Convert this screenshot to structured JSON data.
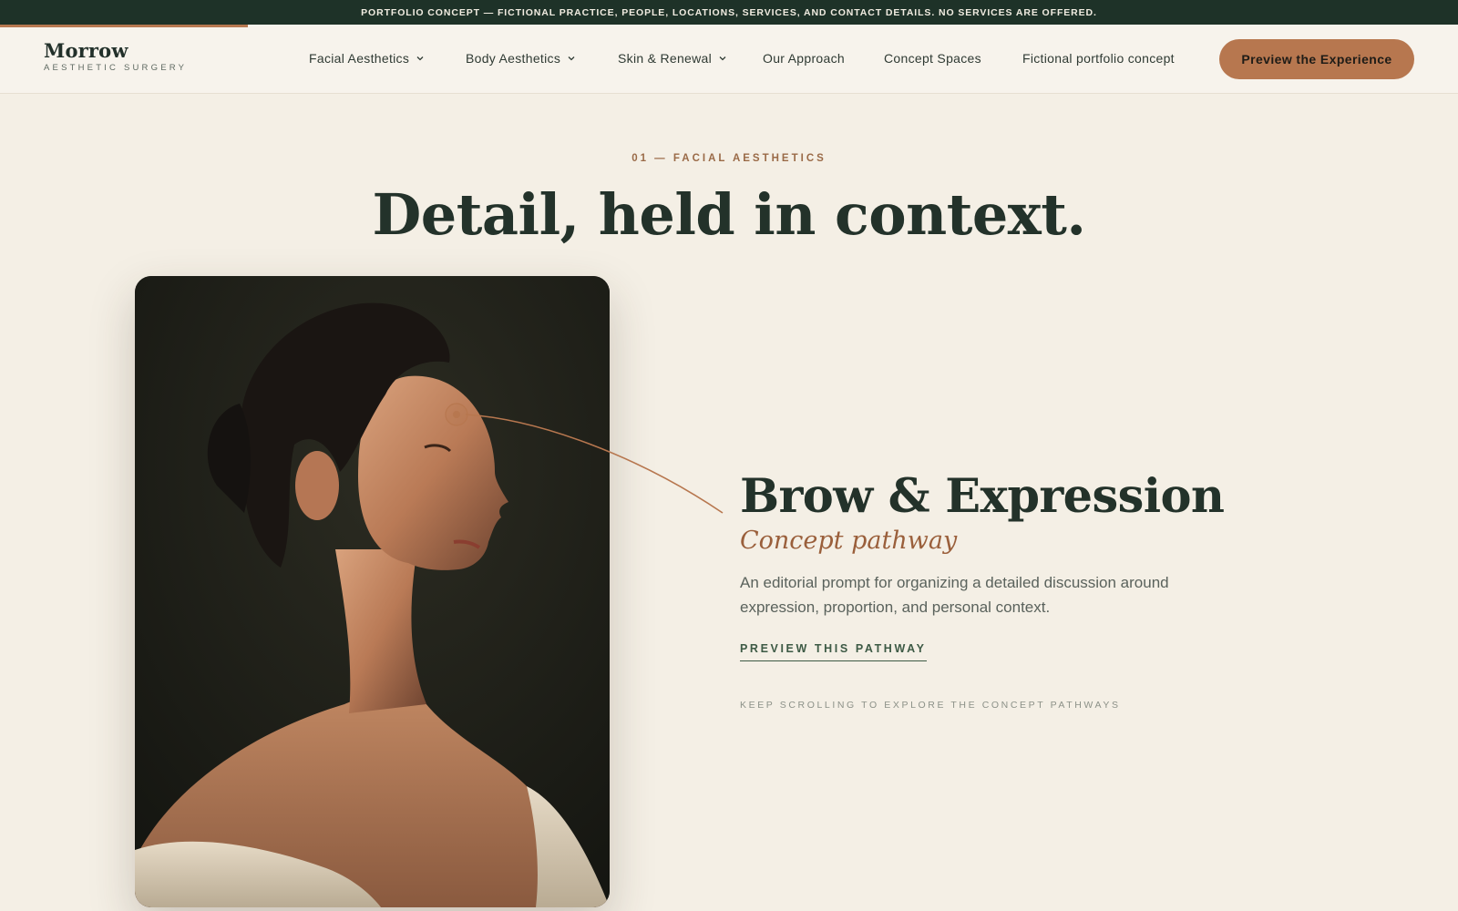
{
  "banner": {
    "text": "PORTFOLIO CONCEPT — FICTIONAL PRACTICE, PEOPLE, LOCATIONS, SERVICES, AND CONTACT DETAILS. NO SERVICES ARE OFFERED.",
    "scroll_progress": 0.17
  },
  "header": {
    "logo_name": "Morrow",
    "logo_tagline": "AESTHETIC SURGERY",
    "nav": [
      {
        "label": "Facial Aesthetics",
        "dropdown": true
      },
      {
        "label": "Body Aesthetics",
        "dropdown": true
      },
      {
        "label": "Skin & Renewal",
        "dropdown": true
      },
      {
        "label": "Our Approach",
        "dropdown": false
      },
      {
        "label": "Concept Spaces",
        "dropdown": false
      },
      {
        "label": "Fictional portfolio concept",
        "dropdown": false
      }
    ],
    "cta_label": "Preview the Experience"
  },
  "hero": {
    "eyebrow": "01 — FACIAL AESTHETICS",
    "headline": "Detail, held in context."
  },
  "feature": {
    "title": "Brow & Expression",
    "subtitle": "Concept pathway",
    "description": "An editorial prompt for organizing a detailed discussion around expression, proportion, and personal context.",
    "link_label": "PREVIEW THIS PATHWAY",
    "scroll_hint": "KEEP SCROLLING TO EXPLORE THE CONCEPT PATHWAYS"
  },
  "icons": {
    "dropdown": "chevron-down-icon",
    "hotspot": "target-dot-icon"
  },
  "colors": {
    "banner_bg": "#1e3228",
    "accent": "#b7774f",
    "page_bg": "#f4efe5",
    "heading": "#23322a",
    "link": "#3d5a45"
  }
}
